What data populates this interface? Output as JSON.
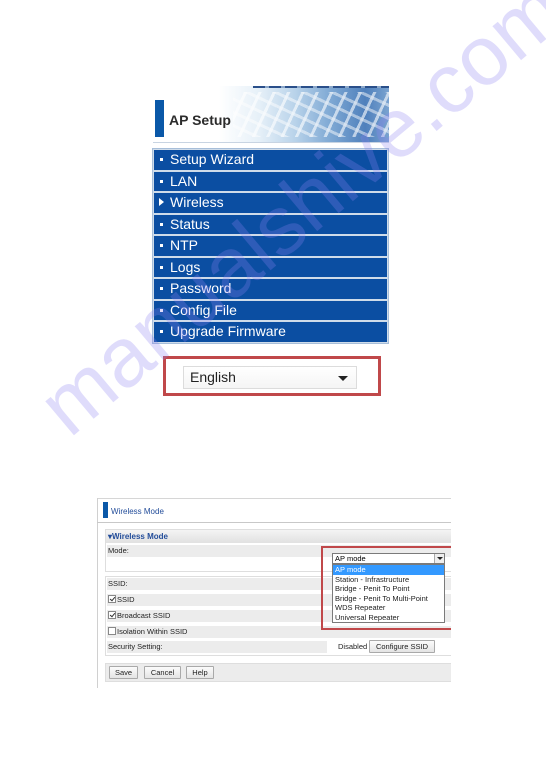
{
  "ap_setup": {
    "title": "AP Setup",
    "menu": [
      {
        "label": "Setup Wizard",
        "active": false
      },
      {
        "label": "LAN",
        "active": false
      },
      {
        "label": "Wireless",
        "active": true
      },
      {
        "label": "Status",
        "active": false
      },
      {
        "label": "NTP",
        "active": false
      },
      {
        "label": "Logs",
        "active": false
      },
      {
        "label": "Password",
        "active": false
      },
      {
        "label": "Config File",
        "active": false
      },
      {
        "label": "Upgrade Firmware",
        "active": false
      }
    ],
    "language_select": {
      "value": "English"
    }
  },
  "wireless_mode": {
    "page_title": "Wireless Mode",
    "section_title": "Wireless Mode",
    "mode_label": "Mode:",
    "mode_select": {
      "value": "AP mode",
      "options": [
        "AP mode",
        "Station - Infrastructure",
        "Bridge - Penit To Point",
        "Bridge - Penit To Multi-Point",
        "WDS Repeater",
        "Universal Repeater"
      ],
      "highlighted_index": 0
    },
    "ssid_label": "SSID:",
    "checkboxes": [
      {
        "label": "SSID",
        "checked": true
      },
      {
        "label": "Broadcast SSID",
        "checked": true
      },
      {
        "label": "Isolation Within SSID",
        "checked": false
      }
    ],
    "security_label": "Security Setting:",
    "security_status": "Disabled",
    "configure_button": "Configure SSID",
    "buttons": {
      "save": "Save",
      "cancel": "Cancel",
      "help": "Help"
    }
  },
  "highlight_color": "#c0484a",
  "menu_color": "#0b4ea2",
  "watermark": "manualshive.com"
}
